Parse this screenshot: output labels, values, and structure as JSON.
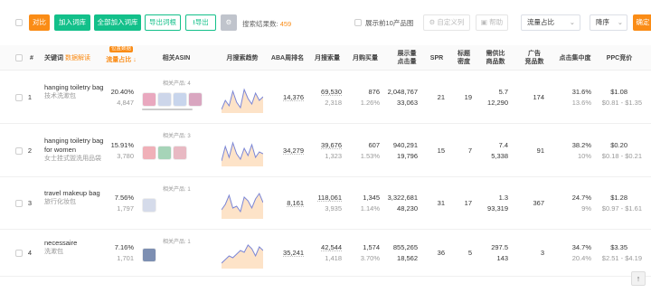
{
  "toolbar": {
    "compare": "对比",
    "add_to_list": "加入词库",
    "add_all_to_list": "全部加入词库",
    "export_root": "导出词根",
    "export": "导出",
    "result_label": "搜索结果数:",
    "result_count": "459",
    "show_top10": "展示前10产品图",
    "custom_columns": "自定义列",
    "help": "帮助",
    "sort_field": "流量占比",
    "sort_order": "降序",
    "confirm": "确定"
  },
  "columns": {
    "index": "#",
    "keyword": "关键词",
    "keyword_tag": "数据解读",
    "traffic_share": "流量占比",
    "traffic_badge": "位置数据",
    "asin": "相关ASIN",
    "trend": "月搜索趋势",
    "aba": "ABA周排名",
    "monthly_search": "月搜索量",
    "monthly_purchase": "月购买量",
    "impressions": "展示量\n点击量",
    "spr": "SPR",
    "title_density": "标题\n密度",
    "supply_demand": "需供比\n商品数",
    "ads": "广告\n竞品数",
    "click_concentration": "点击集中度",
    "ppc": "PPC竞价"
  },
  "rows": [
    {
      "index": "1",
      "kw": "hanging toiletry bag",
      "kw_cn": "技术洗漱包",
      "share": "20.40%",
      "share_sub": "4,847",
      "rel": "相关产品: 4",
      "aba": "14,376",
      "search": "69,530",
      "search_sub": "2,318",
      "purchase": "876",
      "purchase_sub": "1.26%",
      "impr": "2,048,767",
      "clicks": "33,063",
      "spr": "21",
      "density": "19",
      "sd": "5.7",
      "sd_sub": "12,290",
      "ads": "174",
      "conc": "31.6%",
      "conc_sub": "13.6%",
      "ppc": "$1.08",
      "ppc_sub": "$0.81 - $1.35"
    },
    {
      "index": "2",
      "kw": "hanging toiletry bag for women",
      "kw_cn": "女士挂式盥洗用品袋",
      "share": "15.91%",
      "share_sub": "3,780",
      "rel": "相关产品: 3",
      "aba": "34,279",
      "search": "39,676",
      "search_sub": "1,323",
      "purchase": "607",
      "purchase_sub": "1.53%",
      "impr": "940,291",
      "clicks": "19,796",
      "spr": "15",
      "density": "7",
      "sd": "7.4",
      "sd_sub": "5,338",
      "ads": "91",
      "conc": "38.2%",
      "conc_sub": "10%",
      "ppc": "$0.20",
      "ppc_sub": "$0.18 - $0.21"
    },
    {
      "index": "3",
      "kw": "travel makeup bag",
      "kw_cn": "旅行化妆包",
      "share": "7.56%",
      "share_sub": "1,797",
      "rel": "相关产品: 1",
      "aba": "8,161",
      "search": "118,061",
      "search_sub": "3,935",
      "purchase": "1,345",
      "purchase_sub": "1.14%",
      "impr": "3,322,681",
      "clicks": "48,230",
      "spr": "31",
      "density": "17",
      "sd": "1.3",
      "sd_sub": "93,319",
      "ads": "367",
      "conc": "24.7%",
      "conc_sub": "9%",
      "ppc": "$1.28",
      "ppc_sub": "$0.97 - $1.61"
    },
    {
      "index": "4",
      "kw": "necessaire",
      "kw_cn": "洗漱包",
      "share": "7.16%",
      "share_sub": "1,701",
      "rel": "相关产品: 1",
      "aba": "35,241",
      "search": "42,544",
      "search_sub": "1,418",
      "purchase": "1,574",
      "purchase_sub": "3.70%",
      "impr": "855,265",
      "clicks": "18,562",
      "spr": "36",
      "density": "5",
      "sd": "297.5",
      "sd_sub": "143",
      "ads": "3",
      "conc": "34.7%",
      "conc_sub": "20.4%",
      "ppc": "$3.35",
      "ppc_sub": "$2.51 - $4.19"
    }
  ],
  "colors": {
    "accent_orange": "#fa8c16",
    "accent_green": "#13c08a",
    "spark_line": "#7b86d6",
    "spark_fill": "#fde3c8"
  }
}
